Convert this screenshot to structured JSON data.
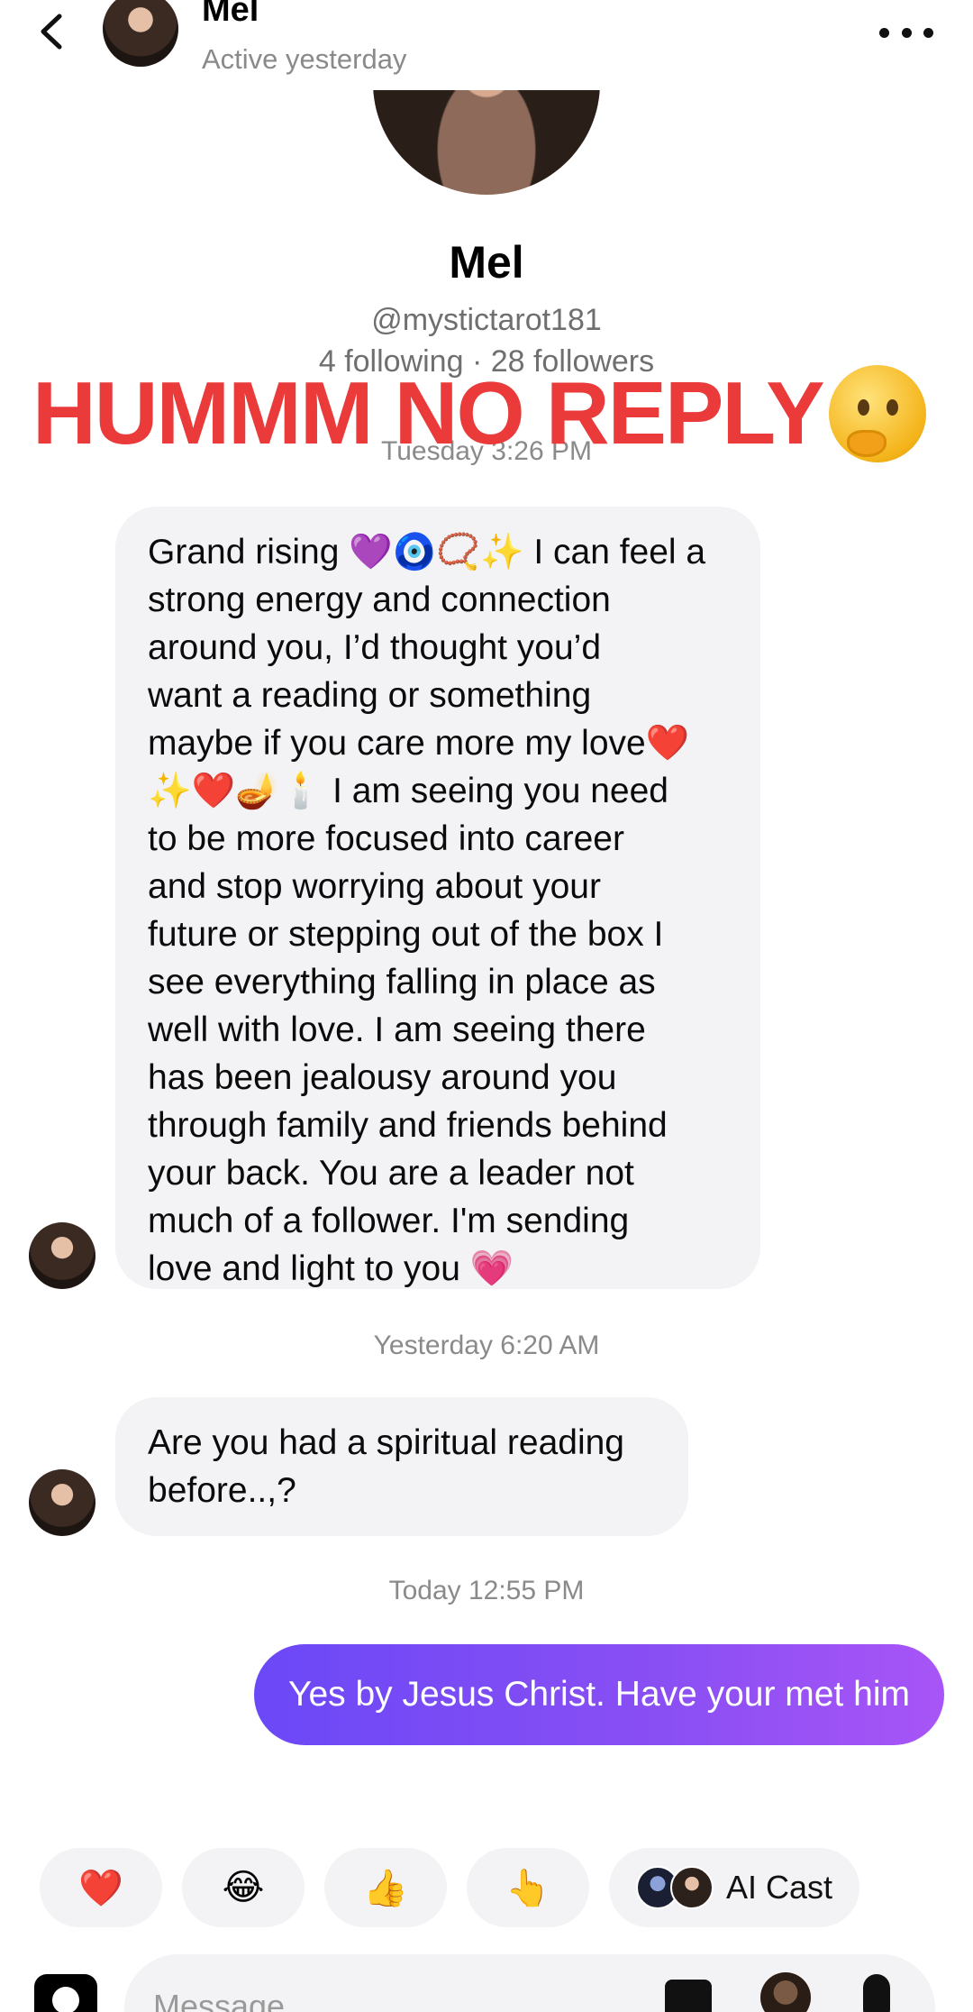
{
  "header": {
    "name": "Mel",
    "status": "Active yesterday"
  },
  "profile": {
    "name": "Mel",
    "handle": "@mystictarot181",
    "stats": "4 following · 28 followers"
  },
  "overlay_text": "HUMMM NO REPLY",
  "messages": [
    {
      "timestamp": "Tuesday 3:26 PM",
      "text": "Grand rising 💜🧿📿✨ I can feel a\nstrong energy and connection\naround  you,  I’d thought you’d\nwant a reading or something\nmaybe if you care more my love❤️\n✨❤️🪔🕯️ I am seeing you need\nto be more focused into career\nand stop worrying about your\nfuture or stepping out of the box I\nsee everything falling in place as\nwell with love. I am seeing there\nhas been jealousy around you\nthrough family and friends behind\nyour back. You are a leader not\nmuch of a follower. I'm sending\nlove and light to you 💗"
    },
    {
      "timestamp": "Yesterday 6:20 AM",
      "text": "Are you had a spiritual reading\nbefore..,?"
    },
    {
      "timestamp": "Today 12:55 PM",
      "text": "Yes by Jesus Christ. Have your met him"
    }
  ],
  "quick_reactions": [
    "❤️",
    "😂",
    "👍",
    "👆"
  ],
  "ai_cast_label": "AI Cast",
  "composer": {
    "placeholder": "Message"
  },
  "icons": {
    "back": "chevron-left-icon",
    "more": "more-horizontal-icon",
    "camera": "camera-icon",
    "gallery": "gallery-icon",
    "sticker": "sticker-icon",
    "mic": "microphone-icon"
  }
}
